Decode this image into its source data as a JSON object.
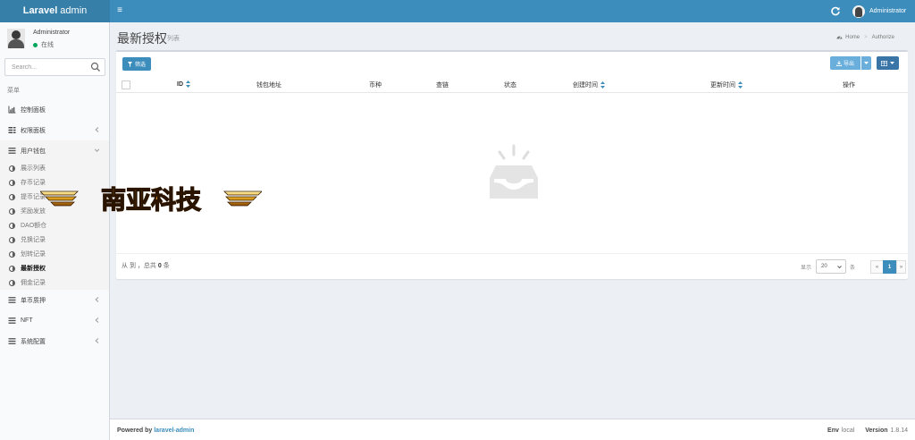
{
  "header": {
    "logo_bold": "Laravel",
    "logo_light": " admin",
    "toggle_symbol": "≡",
    "username": "Administrator"
  },
  "user_panel": {
    "name": "Administrator",
    "status": "在线",
    "status_color": "#00a65a"
  },
  "search": {
    "placeholder": "Search..."
  },
  "sidebar": {
    "menu_header": "菜单",
    "items": [
      {
        "label": "控制面板",
        "icon": "bar-chart-icon"
      },
      {
        "label": "权限面板",
        "icon": "tasks-icon"
      },
      {
        "label": "用户钱包",
        "icon": "bars-icon"
      },
      {
        "label": "单币质押",
        "icon": "bars-icon"
      },
      {
        "label": "NFT",
        "icon": "bars-icon"
      },
      {
        "label": "系统配置",
        "icon": "bars-icon"
      }
    ],
    "subitems": [
      {
        "label": "展示列表"
      },
      {
        "label": "存币记录"
      },
      {
        "label": "提币记录"
      },
      {
        "label": "奖励发放"
      },
      {
        "label": "DAO额仓"
      },
      {
        "label": "兑换记录"
      },
      {
        "label": "划转记录"
      },
      {
        "label": "最新授权"
      },
      {
        "label": "佣金记录"
      }
    ]
  },
  "page": {
    "title": "最新授权",
    "subtitle": "列表",
    "breadcrumb": [
      "Home",
      "Authorize"
    ]
  },
  "toolbar": {
    "filter_label": "筛选",
    "export_label": "导出"
  },
  "table": {
    "columns": [
      "ID",
      "钱包地址",
      "币种",
      "查链",
      "状态",
      "创建时间",
      "更新时间",
      "操作"
    ],
    "rows": []
  },
  "pagination": {
    "summary_prefix": "从 到 ，总共",
    "total": "0",
    "summary_suffix": "条",
    "show_label": "显示",
    "per_page": "20",
    "unit_label": "条",
    "prev": "«",
    "current_page": "1",
    "next": "»"
  },
  "watermark": {
    "text": "南亚科技"
  },
  "footer": {
    "powered_prefix": "Powered by ",
    "powered_link": "laravel-admin",
    "env_label": "Env",
    "env_value": "local",
    "version_label": "Version",
    "version_value": "1.8.14"
  },
  "colors": {
    "header": "#3c8dbc",
    "logo_bg": "#367fa9",
    "sidebar_bg": "#f9fafc",
    "content_bg": "#ecf0f5",
    "primary": "#3c8dbc"
  }
}
